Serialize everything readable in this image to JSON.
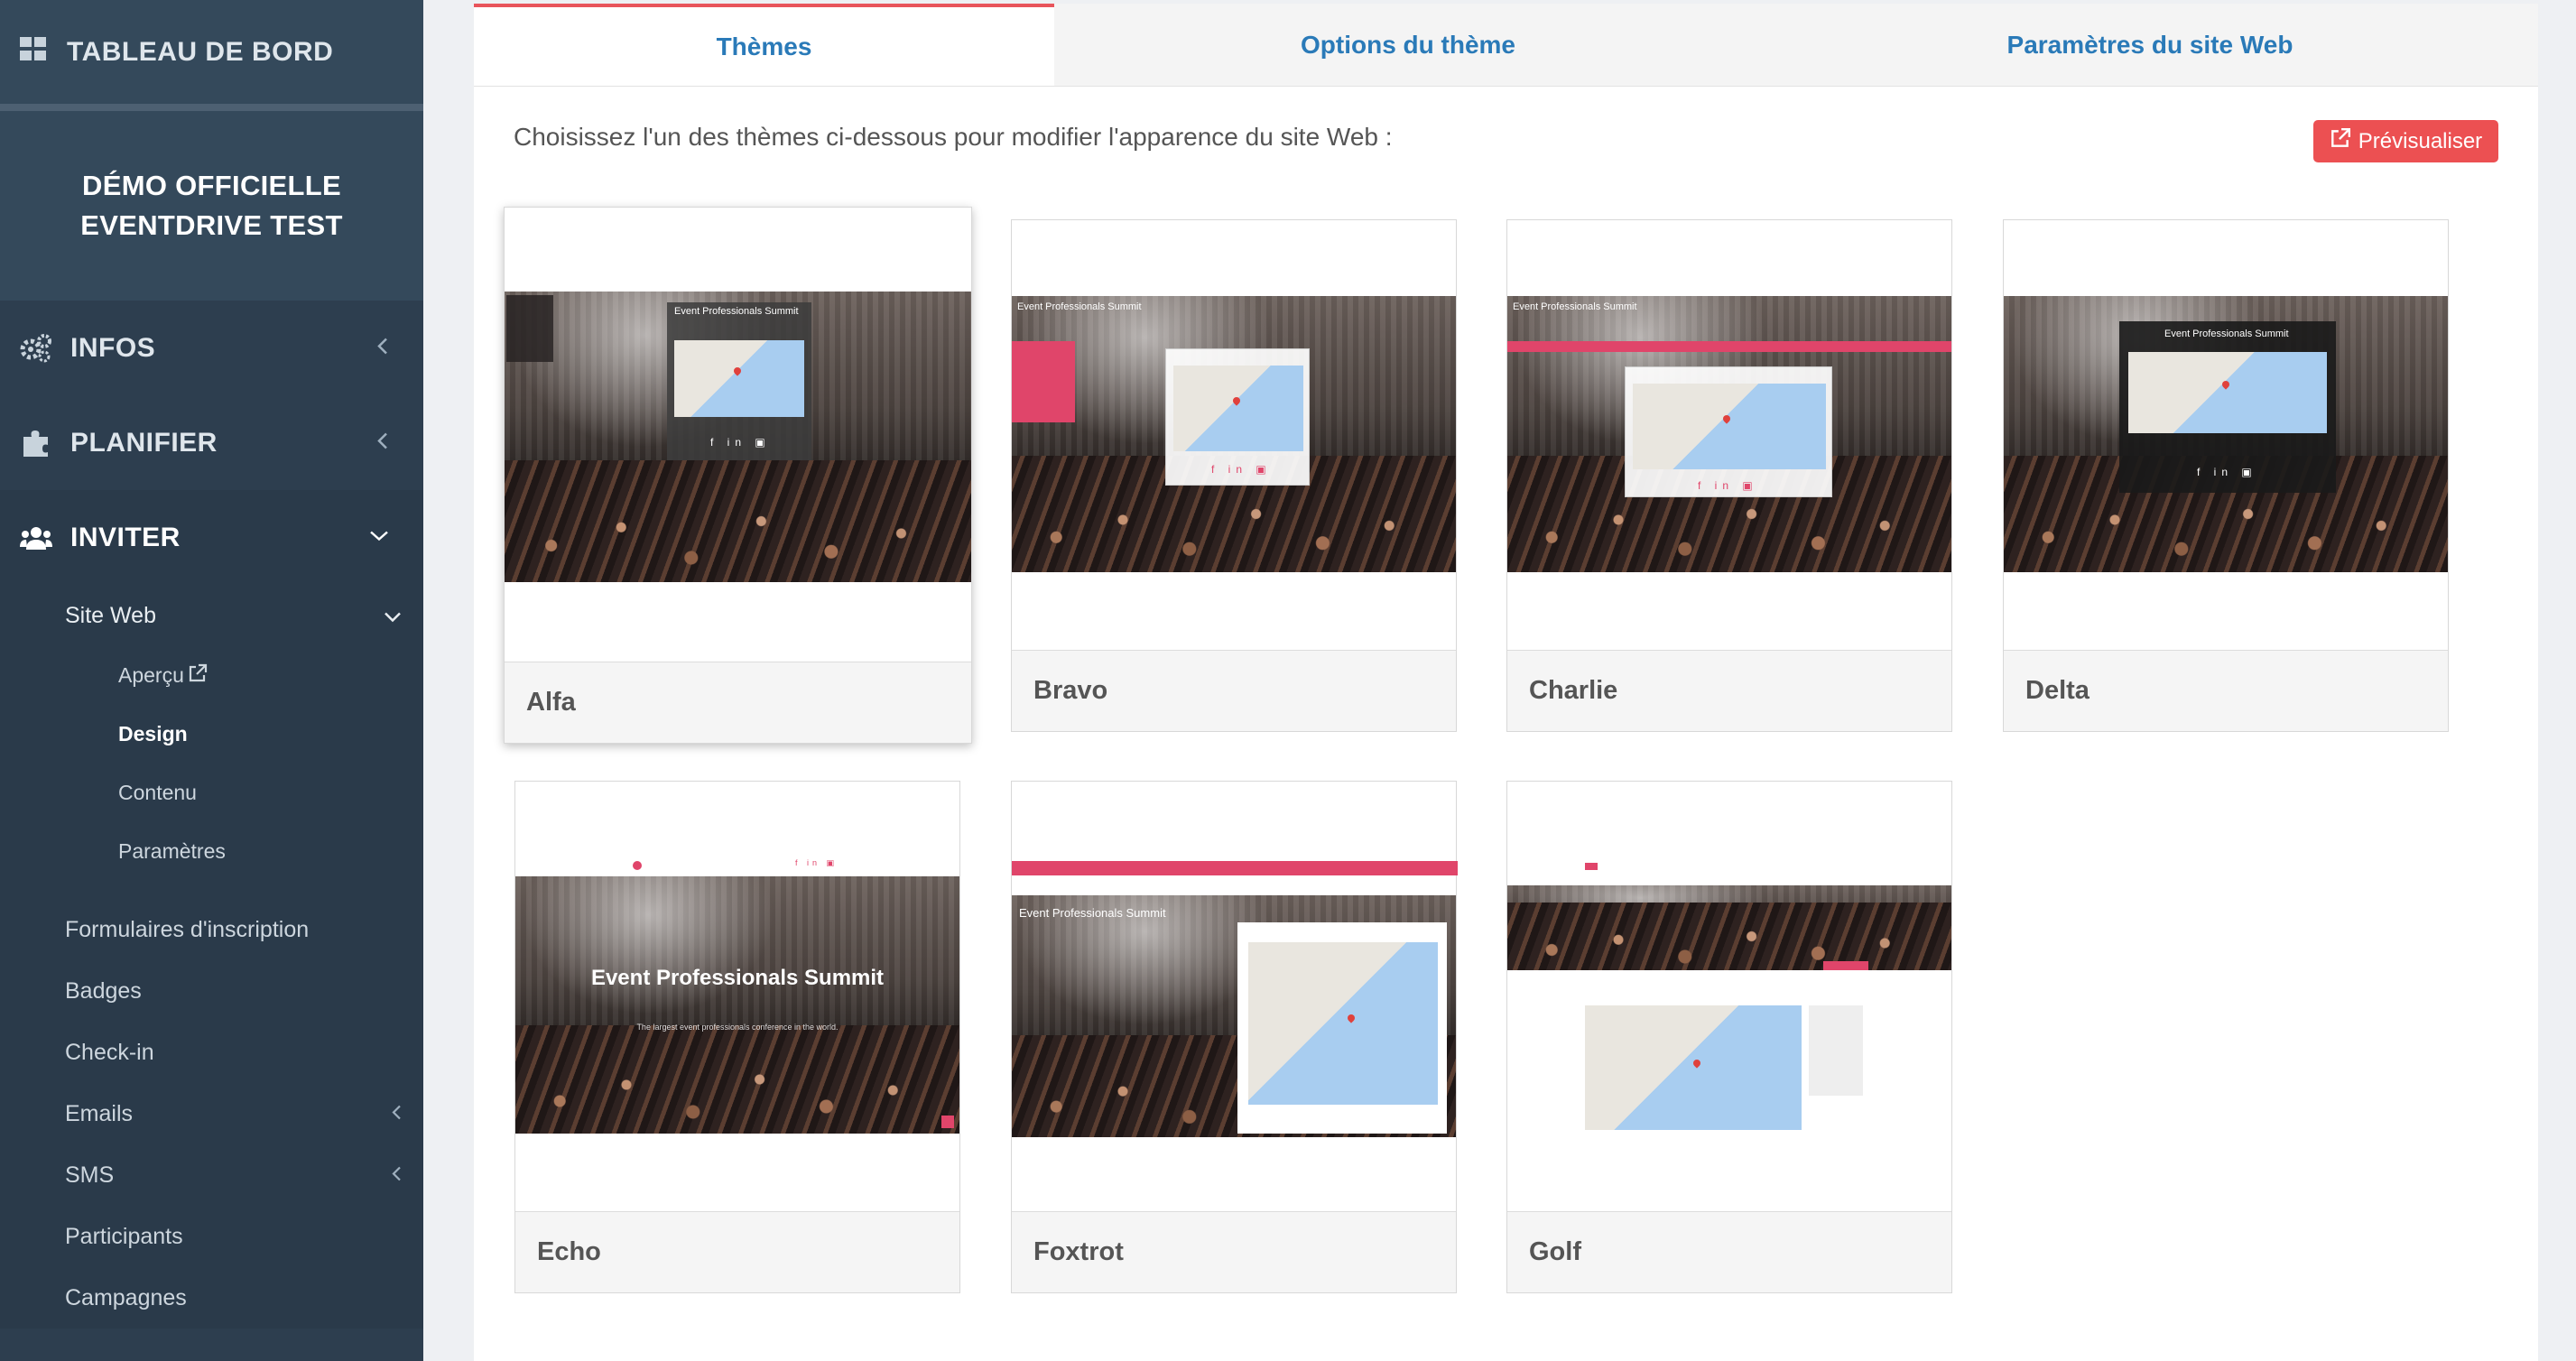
{
  "sidebar": {
    "dashboard_label": "TABLEAU DE BORD",
    "event_name": "DÉMO OFFICIELLE EVENTDRIVE TEST",
    "menu": [
      {
        "label": "INFOS"
      },
      {
        "label": "PLANIFIER"
      },
      {
        "label": "INVITER"
      }
    ],
    "site_web": {
      "label": "Site Web",
      "children": [
        "Aperçu",
        "Design",
        "Contenu",
        "Paramètres"
      ],
      "current": "Design"
    },
    "other_items": [
      "Formulaires d'inscription",
      "Badges",
      "Check-in",
      "Emails",
      "SMS",
      "Participants",
      "Campagnes"
    ]
  },
  "tabs": [
    "Thèmes",
    "Options du thème",
    "Paramètres du site Web"
  ],
  "active_tab": "Thèmes",
  "intro_text": "Choisissez l'un des thèmes ci-dessous pour modifier l'apparence du site Web :",
  "preview_button": "Prévisualiser",
  "themes": [
    {
      "name": "Alfa",
      "selected": true
    },
    {
      "name": "Bravo"
    },
    {
      "name": "Charlie"
    },
    {
      "name": "Delta"
    },
    {
      "name": "Echo"
    },
    {
      "name": "Foxtrot"
    },
    {
      "name": "Golf"
    }
  ],
  "thumbnail_text": {
    "event_title": "Event Professionals Summit",
    "echo_title": "Event Professionals Summit",
    "echo_subtitle": "The largest event professionals conference in the world."
  },
  "colors": {
    "sidebar_bg": "#2d3e4f",
    "tab_text": "#2a7ab8",
    "accent_red": "#ec5052",
    "theme_pink": "#e0456a"
  },
  "icons": {
    "dashboard": "grid-icon",
    "infos": "gears-icon",
    "planifier": "puzzle-icon",
    "inviter": "users-icon",
    "preview": "external-link-icon"
  }
}
